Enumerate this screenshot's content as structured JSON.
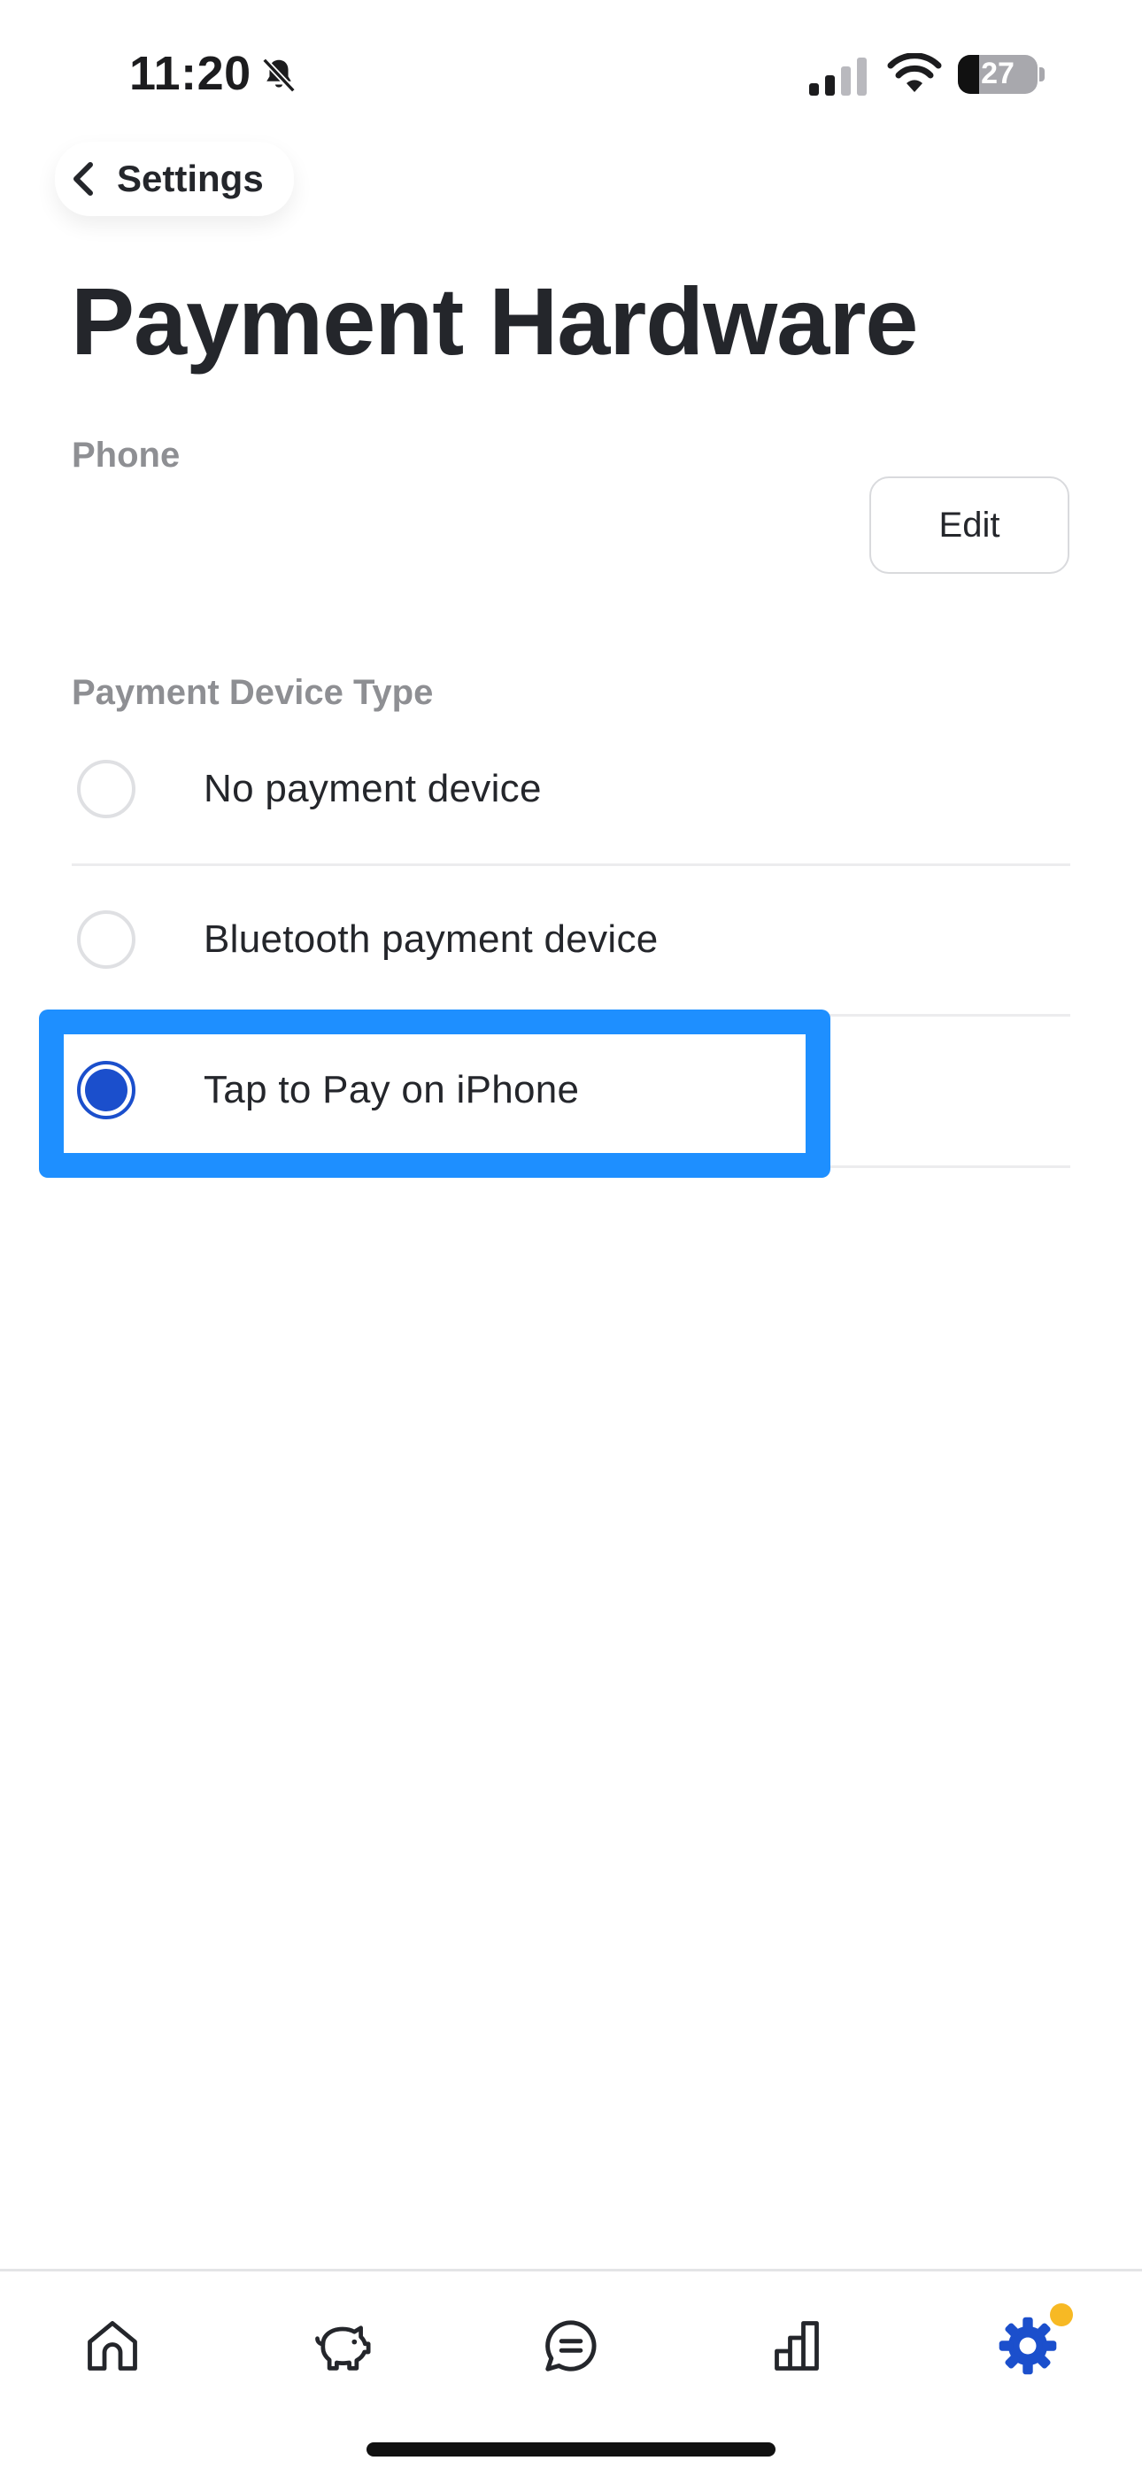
{
  "status_bar": {
    "time": "11:20",
    "battery_level": "27",
    "icons": [
      "bell-slash-icon",
      "signal-icon",
      "wifi-icon",
      "battery-icon"
    ]
  },
  "nav": {
    "back_label": "Settings",
    "back_icon": "chevron-left-icon"
  },
  "page": {
    "title": "Payment Hardware"
  },
  "phone_section": {
    "label": "Phone",
    "edit_label": "Edit"
  },
  "device_section": {
    "label": "Payment Device Type",
    "options": [
      {
        "label": "No payment device",
        "selected": false
      },
      {
        "label": "Bluetooth payment device",
        "selected": false
      },
      {
        "label": "Tap to Pay on iPhone",
        "selected": true
      }
    ]
  },
  "tab_bar": {
    "items": [
      {
        "icon": "home-icon",
        "active": false
      },
      {
        "icon": "piggy-bank-icon",
        "active": false
      },
      {
        "icon": "chat-bubble-icon",
        "active": false
      },
      {
        "icon": "bar-chart-icon",
        "active": false
      },
      {
        "icon": "gear-icon",
        "active": true,
        "badge": true
      }
    ]
  },
  "colors": {
    "accent": "#1b4fcc",
    "highlight": "#1e8fff",
    "badge": "#f7b924",
    "muted_label": "#8e8f93",
    "text": "#24262b"
  }
}
